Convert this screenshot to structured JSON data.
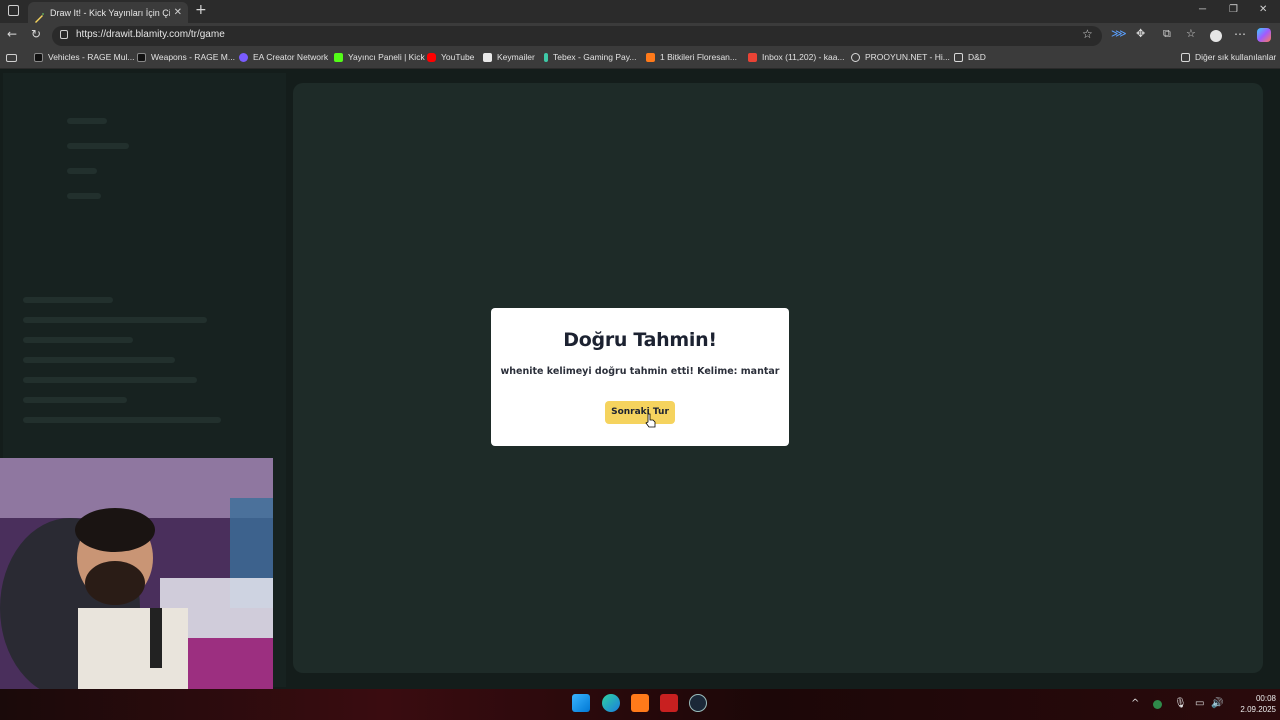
{
  "browser": {
    "tab_title": "Draw It! - Kick Yayınları İçin Çizim",
    "url": "https://drawit.blamity.com/tr/game",
    "bookmarks": [
      {
        "label": "Vehicles - RAGE Mul...",
        "icon": "rage-icon",
        "color": "#d7d7d7"
      },
      {
        "label": "Weapons - RAGE M...",
        "icon": "rage-icon",
        "color": "#d7d7d7"
      },
      {
        "label": "EA Creator Network",
        "icon": "ea-icon",
        "color": "#7a5cff"
      },
      {
        "label": "Yayıncı Paneli | Kick",
        "icon": "kick-icon",
        "color": "#53fc18"
      },
      {
        "label": "YouTube",
        "icon": "youtube-icon",
        "color": "#ff0000"
      },
      {
        "label": "Keymailer",
        "icon": "keymailer-icon",
        "color": "#e8e8e8"
      },
      {
        "label": "Tebex - Gaming Pay...",
        "icon": "tebex-icon",
        "color": "#3ec9a7"
      },
      {
        "label": "1 Bitkileri Floresan...",
        "icon": "bitki-icon",
        "color": "#ff7a1a"
      },
      {
        "label": "Inbox (11,202) - kaa...",
        "icon": "gmail-icon",
        "color": "#ea4335"
      },
      {
        "label": "PROOYUN.NET - Hi...",
        "icon": "globe-icon",
        "color": "#d7d7d7"
      },
      {
        "label": "D&D",
        "icon": "folder-icon",
        "color": "#d7d7d7"
      }
    ],
    "other_bookmarks": "Diğer sık kullanılanlar"
  },
  "modal": {
    "title": "Doğru Tahmin!",
    "message": "whenite kelimeyi doğru tahmin etti! Kelime: mantar",
    "button_label": "Sonraki Tur",
    "accent": "#f5d35e"
  },
  "taskbar": {
    "time": "00:08",
    "date": "2.09.2025"
  }
}
